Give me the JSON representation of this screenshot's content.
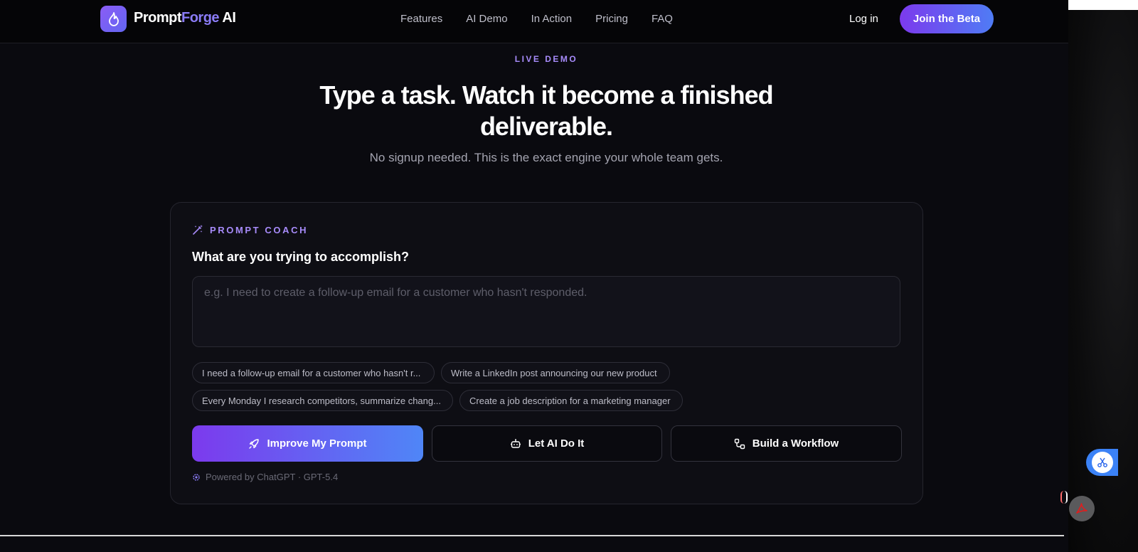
{
  "nav": {
    "logo_word1": "Prompt",
    "logo_word2": "Forge",
    "logo_word3": " AI",
    "links": [
      "Features",
      "AI Demo",
      "In Action",
      "Pricing",
      "FAQ"
    ],
    "login": "Log in",
    "cta": "Join the Beta"
  },
  "hero": {
    "eyebrow": "LIVE DEMO",
    "headline": "Type a task. Watch it become a finished deliverable.",
    "subhead": "No signup needed. This is the exact engine your whole team gets."
  },
  "coach": {
    "label": "PROMPT COACH",
    "question": "What are you trying to accomplish?",
    "input_value": "",
    "input_placeholder": "e.g. I need to create a follow-up email for a customer who hasn't responded.",
    "chips": [
      "I need a follow-up email for a customer who hasn't r...",
      "Write a LinkedIn post announcing our new product",
      "Every Monday I research competitors, summarize chang...",
      "Create a job description for a marketing manager"
    ],
    "buttons": {
      "improve": "Improve My Prompt",
      "let_ai": "Let AI Do It",
      "workflow": "Build a Workflow"
    },
    "powered_by": "Powered by ChatGPT · GPT-5.4"
  },
  "icons": {
    "logo": "flame-icon",
    "coach": "magic-wand-icon",
    "improve": "rocket-icon",
    "let_ai": "robot-icon",
    "workflow": "workflow-icon",
    "powered": "gear-icon",
    "float1": "scissors-icon",
    "float2": "pdf-icon"
  },
  "colors": {
    "accent": "#a78bfa",
    "gradient_start": "#7c3aed",
    "gradient_end": "#4f86f7",
    "background": "#0a0a0f"
  }
}
